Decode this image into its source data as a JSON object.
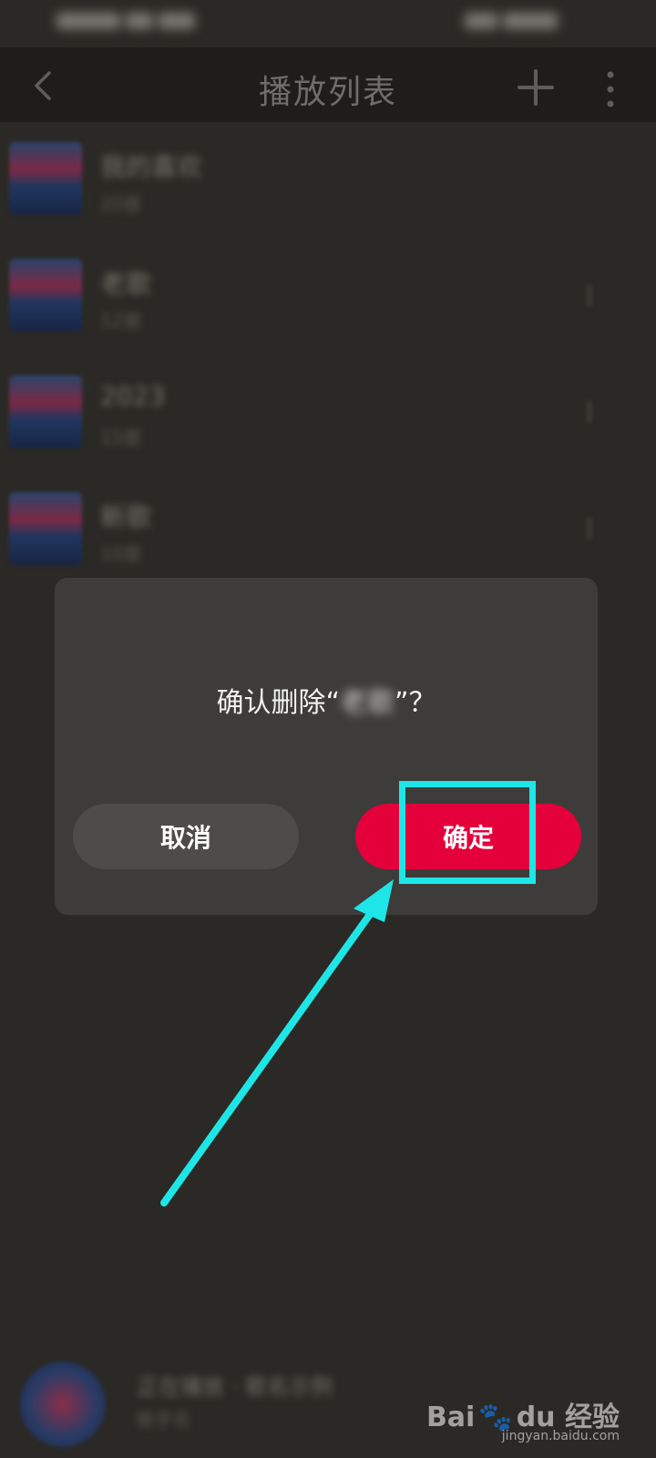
{
  "header": {
    "title": "播放列表"
  },
  "dialog": {
    "message_prefix": "确认删除“",
    "message_name": "老歌",
    "message_suffix": "”？",
    "cancel_label": "取消",
    "confirm_label": "确定"
  },
  "list": {
    "items": [
      {
        "title": "我的喜欢",
        "subtitle": "20首"
      },
      {
        "title": "老歌",
        "subtitle": "12首"
      },
      {
        "title": "2023",
        "subtitle": "15首"
      },
      {
        "title": "新歌",
        "subtitle": "10首"
      }
    ]
  },
  "player": {
    "title": "正在播放 · 歌名示例",
    "subtitle": "歌手名"
  },
  "watermark": {
    "brand": "Bai",
    "brand_suffix": "du",
    "brand_cn": "经验",
    "url": "jingyan.baidu.com"
  },
  "colors": {
    "accent": "#e3003b",
    "annotation": "#1ee6e6",
    "dialog_bg": "#3d3c3a",
    "overlay_bg": "#2b2925"
  }
}
